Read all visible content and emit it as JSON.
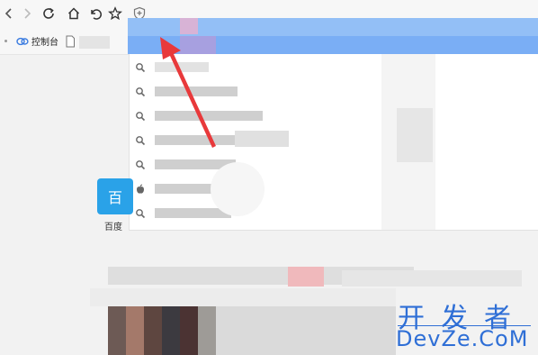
{
  "toolbar": {
    "back_icon": "back-icon",
    "forward_icon": "forward-icon",
    "reload_icon": "reload-icon",
    "home_icon": "home-icon",
    "undo_icon": "undo-icon",
    "star_icon": "star-icon",
    "shield_icon": "shield-icon"
  },
  "bookmarks": {
    "console_label": "控制台"
  },
  "desktop": {
    "tile_glyph": "百",
    "tile_label": "百度"
  },
  "colors": {
    "highlight": "#7aaef5",
    "arrow": "#e8393b",
    "tile": "#2aa2e8",
    "watermark": "#2f6fd6"
  },
  "watermark": {
    "line1": "开发者",
    "line2": "DevZe.CoM"
  }
}
